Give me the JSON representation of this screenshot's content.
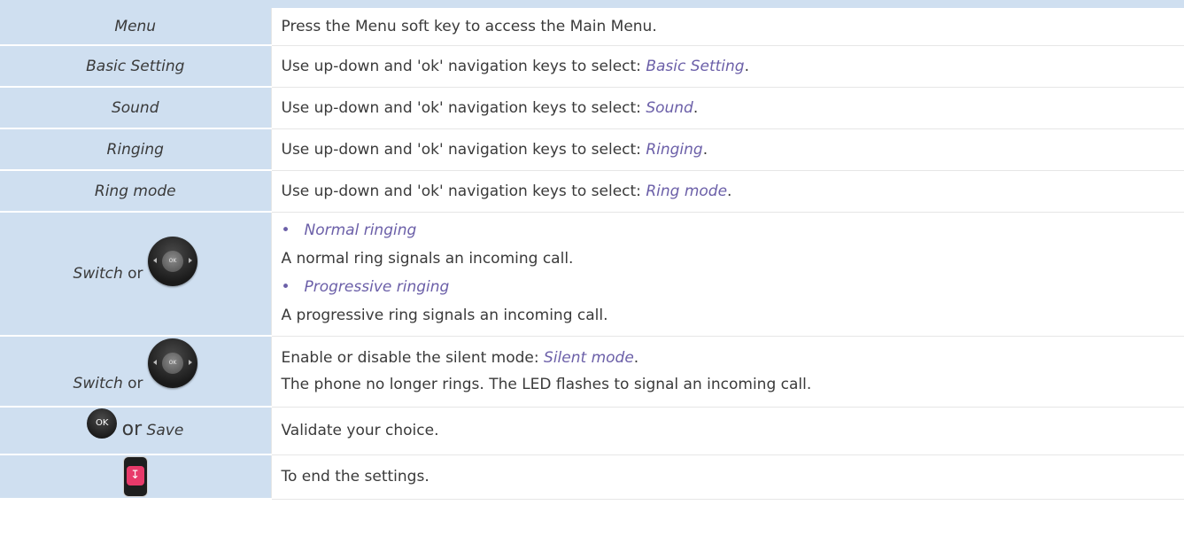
{
  "rows": [
    {
      "left": "Menu",
      "text": "Press the Menu soft key to access the Main Menu."
    },
    {
      "left": "Basic Setting",
      "prefix": "Use up-down and 'ok' navigation keys to select: ",
      "highlight": "Basic Setting",
      "suffix": "."
    },
    {
      "left": "Sound",
      "prefix": "Use up-down and 'ok' navigation keys to select: ",
      "highlight": "Sound",
      "suffix": "."
    },
    {
      "left": "Ringing",
      "prefix": "Use up-down and 'ok' navigation keys to select: ",
      "highlight": "Ringing",
      "suffix": "."
    },
    {
      "left": "Ring mode",
      "prefix": "Use up-down and 'ok' navigation keys to select: ",
      "highlight": "Ring mode",
      "suffix": "."
    }
  ],
  "ring_options": {
    "left_label": "Switch",
    "left_or": "or",
    "bullet": "•",
    "option1": "Normal ringing",
    "option1_desc": "A normal ring signals an incoming call.",
    "option2": "Progressive ringing",
    "option2_desc": "A progressive ring signals an incoming call."
  },
  "silent": {
    "left_label": "Switch",
    "left_or": "or",
    "prefix": "Enable or disable the silent mode: ",
    "highlight": "Silent mode",
    "suffix": ".",
    "desc": "The phone no longer rings. The LED flashes to signal an incoming call."
  },
  "validate": {
    "ok_key_label": "OK",
    "or": "or",
    "save": "Save",
    "text": "Validate your choice."
  },
  "end": {
    "text": "To end the settings.",
    "icon": "hang-up-key"
  },
  "nav_key_label": "OK",
  "colors": {
    "label_bg": "#cfdff0",
    "highlight": "#6b5fa8",
    "text": "#3a3a3a",
    "hangup": "#e83a6a"
  }
}
